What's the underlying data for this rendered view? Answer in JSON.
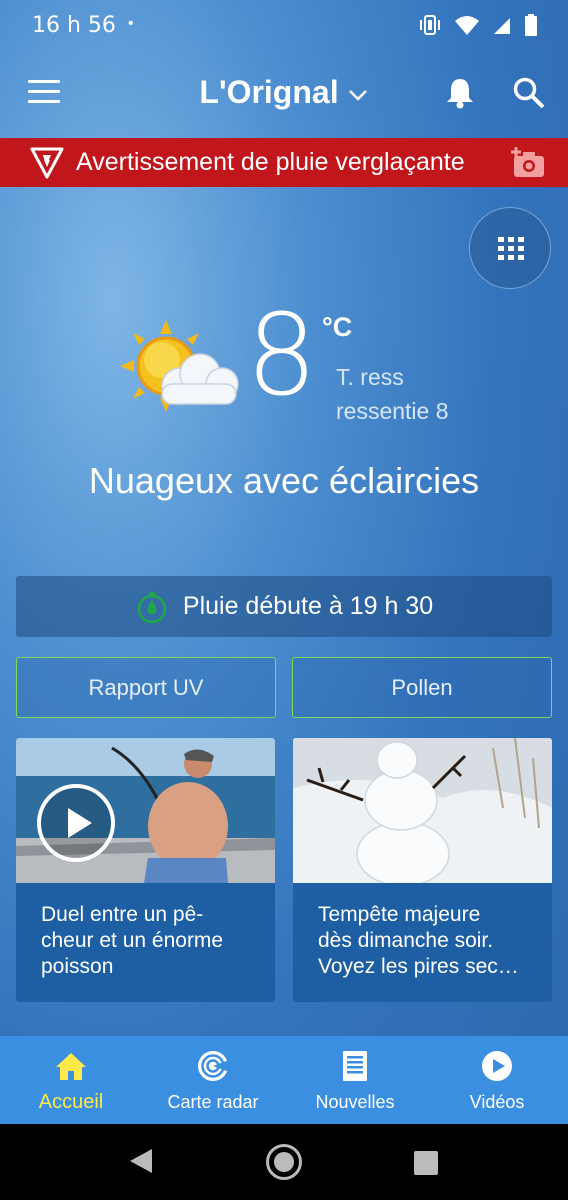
{
  "status_bar": {
    "time": "16 h 56",
    "dot": "•",
    "icons": [
      "vibrate-icon",
      "wifi-icon",
      "signal-icon",
      "battery-icon"
    ]
  },
  "app_bar": {
    "location": "L'Orignal",
    "icons": [
      "menu-icon",
      "chevron-down-icon",
      "bell-icon",
      "search-icon"
    ]
  },
  "warning": {
    "text": "Avertissement de pluie verglaçante",
    "color": "#c0161c",
    "icons": [
      "warning-icon",
      "add-photo-icon"
    ]
  },
  "current": {
    "temperature": "8",
    "unit": "°C",
    "feels_like_line1": "T. ress",
    "feels_like_line2": "ressentie 8",
    "condition": "Nuageux avec éclaircies",
    "icon": "partly-cloudy-icon"
  },
  "precip_notice": {
    "text": "Pluie débute à 19 h 30",
    "icon": "precip-timer-icon"
  },
  "buttons": {
    "uv": "Rapport UV",
    "pollen": "Pollen",
    "border_color": "#7fd85a"
  },
  "news": [
    {
      "title_lines": [
        "Duel entre un pê-",
        "cheur et un énorme",
        "poisson"
      ],
      "has_video": true
    },
    {
      "title_lines": [
        "Tempête majeure",
        "dès dimanche soir.",
        "Voyez les pires sec…"
      ],
      "has_video": false
    }
  ],
  "bottom_nav": {
    "items": [
      {
        "label": "Accueil",
        "icon": "home-icon",
        "active": true
      },
      {
        "label": "Carte radar",
        "icon": "radar-icon",
        "active": false
      },
      {
        "label": "Nouvelles",
        "icon": "news-icon",
        "active": false
      },
      {
        "label": "Vidéos",
        "icon": "video-play-icon",
        "active": false
      }
    ],
    "active_color": "#ffe94a",
    "background": "#3a8fe0"
  }
}
